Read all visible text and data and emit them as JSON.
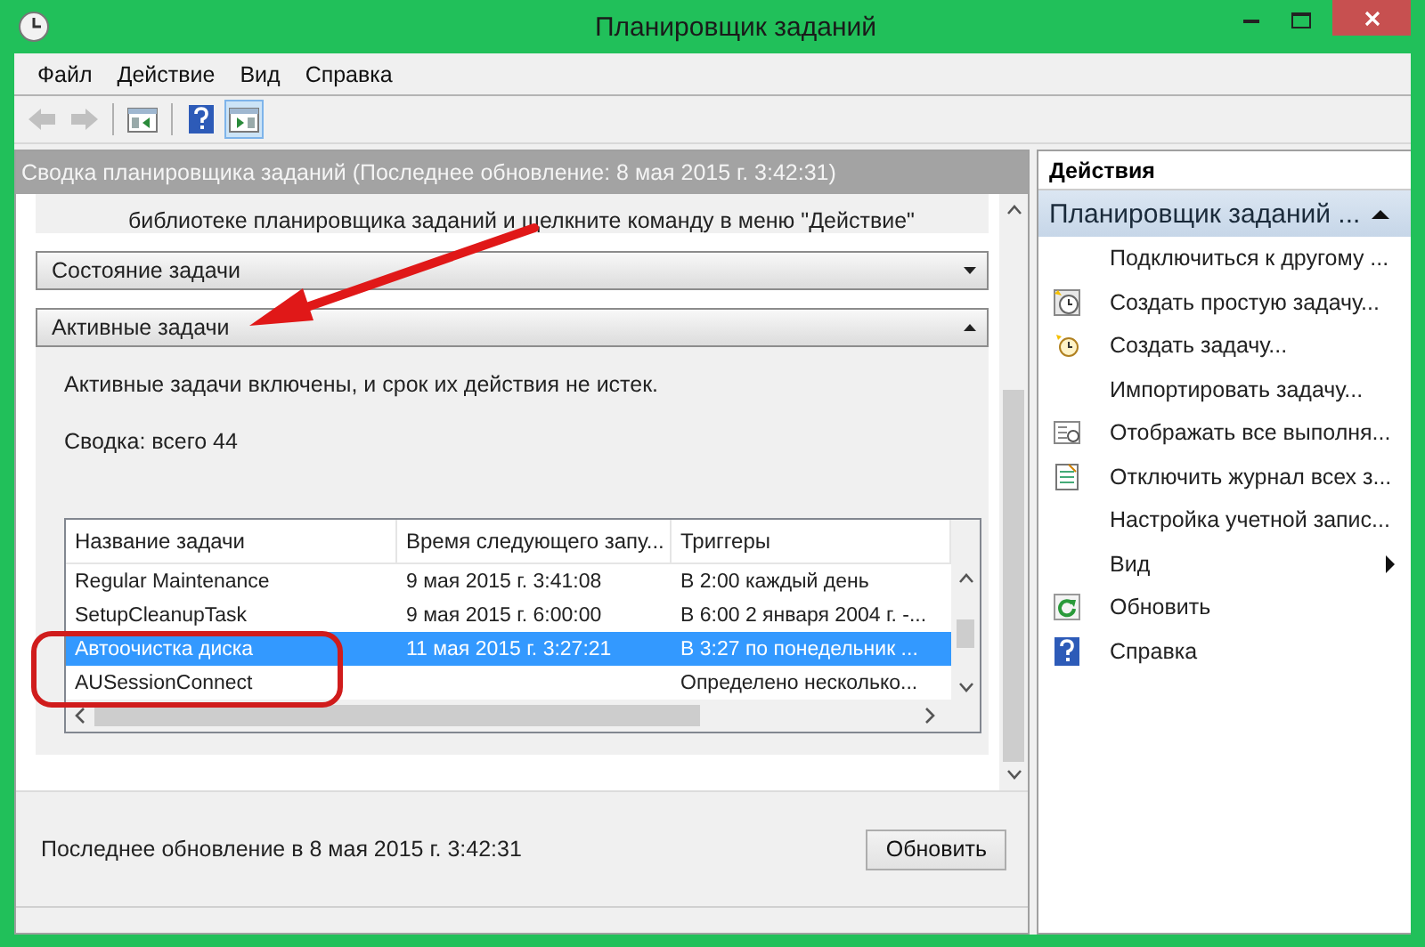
{
  "window": {
    "title": "Планировщик заданий"
  },
  "menu": [
    {
      "label": "Файл"
    },
    {
      "label": "Действие"
    },
    {
      "label": "Вид"
    },
    {
      "label": "Справка"
    }
  ],
  "toolbar": [
    {
      "kind": "back",
      "disabled": true,
      "pressed": false
    },
    {
      "kind": "forward",
      "disabled": true,
      "pressed": false
    },
    {
      "kind": "tree",
      "disabled": false,
      "pressed": false
    },
    {
      "kind": "help",
      "disabled": false,
      "pressed": false
    },
    {
      "kind": "pane",
      "disabled": false,
      "pressed": true
    }
  ],
  "summary_header": "Сводка планировщика заданий (Последнее обновление: 8 мая 2015 г. 3:42:31)",
  "intro_text": "библиотеке планировщика заданий и щелкните команду в меню \"Действие\"",
  "sections": [
    {
      "title": "Состояние задачи",
      "expanded": false
    },
    {
      "title": "Активные задачи",
      "expanded": true
    }
  ],
  "active_tasks": {
    "status_text": "Активные задачи включены, и срок их действия не истек.",
    "summary": "Сводка: всего 44",
    "table": {
      "columns": [
        "Название задачи",
        "Время следующего запу...",
        "Триггеры"
      ],
      "rows": [
        {
          "cells": [
            "Regular Maintenance",
            "9 мая 2015 г. 3:41:08",
            "В 2:00 каждый день"
          ],
          "selected": false
        },
        {
          "cells": [
            "SetupCleanupTask",
            "9 мая 2015 г. 6:00:00",
            "В 6:00 2 января 2004 г. -..."
          ],
          "selected": false
        },
        {
          "cells": [
            "Автоочистка диска",
            "11 мая 2015 г. 3:27:21",
            "В 3:27 по понедельник ..."
          ],
          "selected": true
        },
        {
          "cells": [
            "AUSessionConnect",
            "",
            "Определено несколько..."
          ],
          "selected": false
        }
      ]
    }
  },
  "footer": {
    "last_update": "Последнее обновление в 8 мая 2015 г. 3:42:31",
    "refresh_button": "Обновить"
  },
  "actions_pane": {
    "title": "Действия",
    "group": {
      "title": "Планировщик заданий ...",
      "expanded": true
    },
    "items": [
      {
        "label": "Подключиться к другому ...",
        "kind": "plain"
      },
      {
        "label": "Создать простую задачу...",
        "kind": "wizard"
      },
      {
        "label": "Создать задачу...",
        "kind": "new"
      },
      {
        "label": "Импортировать задачу...",
        "kind": "plain"
      },
      {
        "label": "Отображать все выполня...",
        "kind": "running"
      },
      {
        "label": "Отключить журнал всех з...",
        "kind": "journal"
      },
      {
        "label": "Настройка учетной запис...",
        "kind": "plain"
      },
      {
        "label": "Вид",
        "kind": "submenu"
      },
      {
        "label": "Обновить",
        "kind": "refresh"
      },
      {
        "label": "Справка",
        "kind": "help"
      }
    ]
  }
}
